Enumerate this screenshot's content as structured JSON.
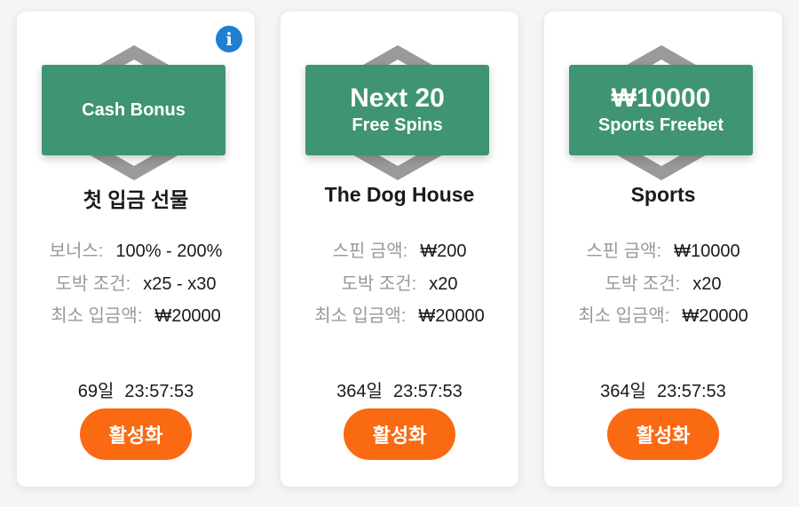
{
  "cards": [
    {
      "badge_main": "",
      "badge_sub": "Cash Bonus",
      "title": "첫 입금 선물",
      "rows": [
        {
          "label": "보너스:",
          "value": "100% - 200%"
        },
        {
          "label": "도박 조건:",
          "value": "x25 - x30"
        },
        {
          "label": "최소 입금액:",
          "value": "₩20000"
        }
      ],
      "timer_days": "69일",
      "timer_time": "23:57:53",
      "button_label": "활성화",
      "has_info": true
    },
    {
      "badge_main": "Next 20",
      "badge_sub": "Free Spins",
      "title": "The Dog House",
      "rows": [
        {
          "label": "스핀 금액:",
          "value": "₩200"
        },
        {
          "label": "도박 조건:",
          "value": "x20"
        },
        {
          "label": "최소 입금액:",
          "value": "₩20000"
        }
      ],
      "timer_days": "364일",
      "timer_time": "23:57:53",
      "button_label": "활성화",
      "has_info": false
    },
    {
      "badge_main": "₩10000",
      "badge_sub": "Sports Freebet",
      "title": "Sports",
      "rows": [
        {
          "label": "스핀 금액:",
          "value": "₩10000"
        },
        {
          "label": "도박 조건:",
          "value": "x20"
        },
        {
          "label": "최소 입금액:",
          "value": "₩20000"
        }
      ],
      "timer_days": "364일",
      "timer_time": "23:57:53",
      "button_label": "활성화",
      "has_info": false
    }
  ],
  "info_icon": {
    "glyph": "i",
    "icon": "info-icon"
  },
  "colors": {
    "badge": "#3f9471",
    "button": "#f96a12",
    "info": "#1f7fd1",
    "hexagon": "#9a9a9a"
  }
}
